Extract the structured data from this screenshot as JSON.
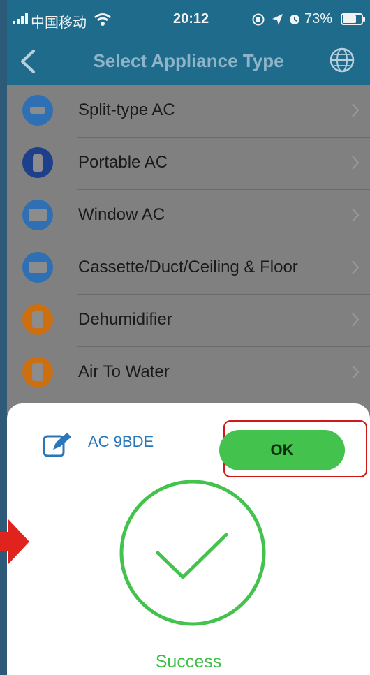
{
  "status_bar": {
    "carrier": "中国移动",
    "time": "20:12",
    "battery": "73%",
    "battery_level": 0.73,
    "icons": [
      "signal-bars-icon",
      "wifi-icon",
      "orientation-lock-icon",
      "location-arrow-icon",
      "alarm-icon",
      "battery-icon"
    ]
  },
  "nav": {
    "title": "Select Appliance Type",
    "back_icon": "back-chevron-icon",
    "right_icon": "globe-icon"
  },
  "appliances": [
    {
      "label": "Split-type AC",
      "icon": "split-ac-icon",
      "color": "#2f6fb3"
    },
    {
      "label": "Portable AC",
      "icon": "portable-ac-icon",
      "color": "#1e3f8c"
    },
    {
      "label": "Window AC",
      "icon": "window-ac-icon",
      "color": "#2f6fb3"
    },
    {
      "label": "Cassette/Duct/Ceiling & Floor",
      "icon": "cassette-ac-icon",
      "color": "#2f6fb3"
    },
    {
      "label": "Dehumidifier",
      "icon": "dehumidifier-icon",
      "color": "#cc6f10"
    },
    {
      "label": "Air To Water",
      "icon": "air-to-water-icon",
      "color": "#cc6f10"
    }
  ],
  "sheet": {
    "device_name": "AC 9BDE",
    "ok_label": "OK",
    "success_text": "Success"
  },
  "colors": {
    "nav_bar": "#1e6b8c",
    "ok_green": "#44c24e",
    "success_green": "#3fbf48",
    "highlight_red": "#d01818",
    "device_name_blue": "#2a76b8"
  }
}
